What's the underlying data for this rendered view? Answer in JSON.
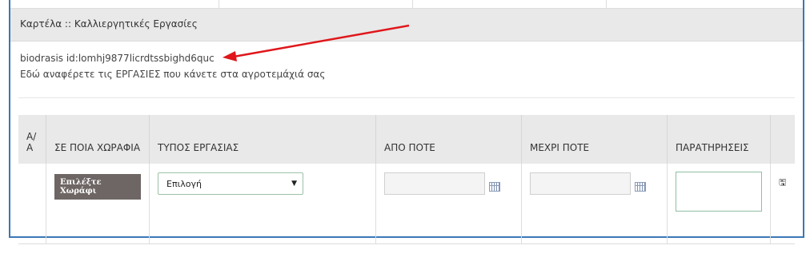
{
  "panel": {
    "title": "Καρτέλα :: Καλλιεργητικές Εργασίες",
    "id_line": "biodrasis id:lomhj9877licrdtssbighd6quc",
    "description": "Εδώ αναφέρετε τις ΕΡΓΑΣΙΕΣ που κάνετε στα αγροτεμάχιά σας"
  },
  "table": {
    "headers": [
      "Α/Α",
      "ΣΕ ΠΟΙΑ ΧΩΡΑΦΙΑ",
      "ΤΥΠΟΣ ΕΡΓΑΣΙΑΣ",
      "ΑΠΟ ΠΟΤΕ",
      "ΜΕΧΡΙ ΠΟΤΕ",
      "ΠΑΡΑΤΗΡΗΣΕΙΣ",
      ""
    ],
    "row": {
      "field_button": "Επιλέξτε Χωράφι",
      "type_select_value": "Επιλογή",
      "from_value": "",
      "to_value": "",
      "notes_value": ""
    }
  },
  "icons": {
    "calendar": "calendar-icon",
    "save": "save-icon",
    "dropdown": "chevron-down-icon"
  },
  "colors": {
    "frame_border": "#3a77b7",
    "header_bg": "#e9e9e9",
    "annotation_arrow": "#e0161a",
    "field_button_bg": "#6e6664"
  }
}
